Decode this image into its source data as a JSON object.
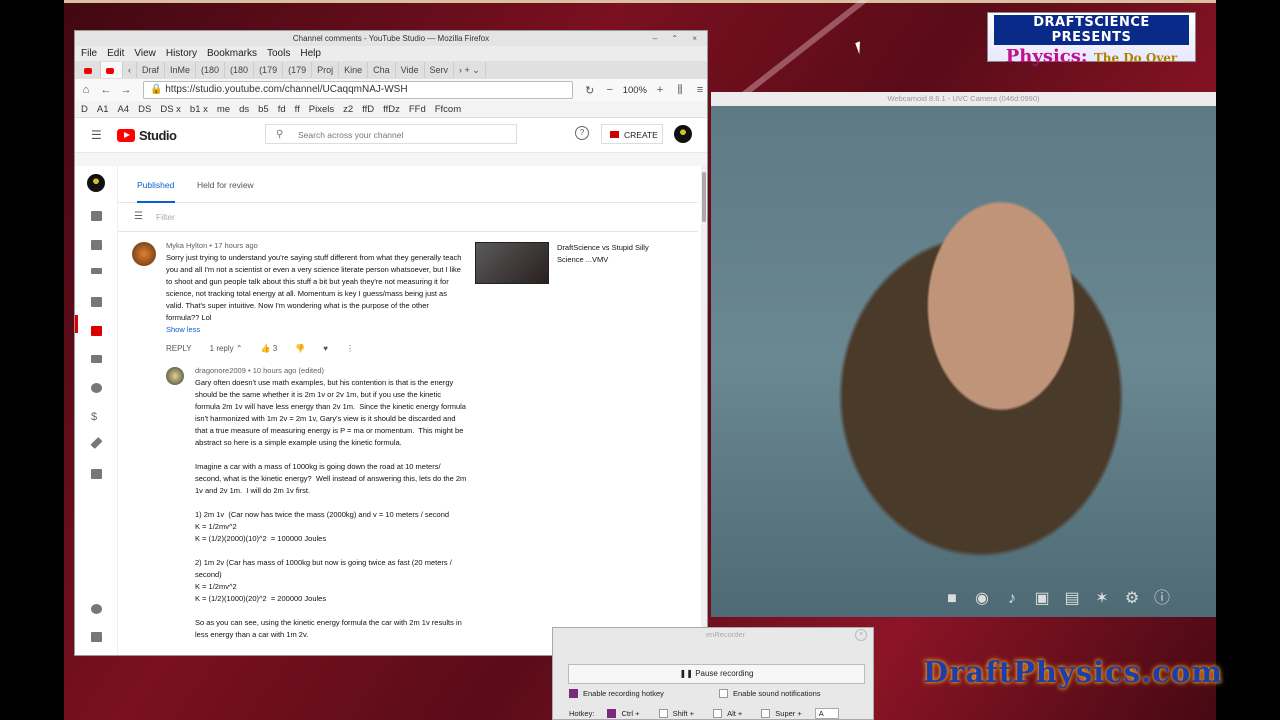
{
  "banner": {
    "line1": "DRAFTSCIENCE PRESENTS",
    "line2": "Physics:",
    "line2_sub": "The Do Over"
  },
  "firefox": {
    "title": "Channel comments - YouTube Studio — Mozilla Firefox",
    "menu": [
      "File",
      "Edit",
      "View",
      "History",
      "Bookmarks",
      "Tools",
      "Help"
    ],
    "tabs": [
      "Draf",
      "InMe",
      "(180",
      "(180",
      "(179",
      "(179",
      "Proj",
      "Kine",
      "Cha",
      "Vide",
      "Serv"
    ],
    "url": "https://studio.youtube.com/channel/UCaqqmNAJ-WSH",
    "zoom": "100%",
    "bookmarks": [
      "D",
      "A1",
      "A4",
      "DS",
      "DS x",
      "b1 x",
      "me",
      "ds",
      "b5",
      "fd",
      "ff",
      "Pixels",
      "z2",
      "ffD",
      "ffDz",
      "FFd",
      "Ffcom"
    ]
  },
  "studio": {
    "logo_text": "Studio",
    "search_placeholder": "Search across your channel",
    "create_label": "CREATE",
    "tab_published": "Published",
    "tab_held": "Held for review",
    "filter_placeholder": "Filter"
  },
  "comment1": {
    "author": "Myka Hylton",
    "time": "17 hours ago",
    "text": "Sorry just trying to understand you're saying stuff different from what they generally teach\nyou and all I'm not a scientist or even a very science literate person whatsoever, but I like\nto shoot and gun people talk about this stuff a bit but yeah they're not measuring it for\nscience, not tracking total energy at all. Momentum is key I guess/mass being just as\nvalid. That's super intuitive. Now I'm wondering what is the purpose of the other\nformula?? Lol",
    "show_less": "Show less",
    "reply": "REPLY",
    "replies": "1 reply",
    "likes": "3",
    "video_title": "DraftScience vs Stupid Silly Science ...VMV"
  },
  "comment2": {
    "author": "dragonore2009",
    "time": "10 hours ago (edited)",
    "text": "Gary often doesn't use math examples, but his contention is that is the energy\nshould be the same whether it is 2m 1v or 2v 1m, but if you use the kinetic\nformula 2m 1v will have less energy than 2v 1m.  Since the kinetic energy formula\nisn't harmonized with 1m 2v = 2m 1v, Gary's view is it should be discarded and\nthat a true measure of measuring energy is P = ma or momentum.  This might be\nabstract so here is a simple example using the kinetic formula.\n\nImagine a car with a mass of 1000kg is going down the road at 10 meters/\nsecond, what is the kinetic energy?  Well instead of answering this, lets do the 2m\n1v and 2v 1m.  I will do 2m 1v first.\n\n1) 2m 1v  (Car now has twice the mass (2000kg) and v = 10 meters / second\nK = 1/2mv^2\nK = (1/2)(2000)(10)^2  = 100000 Joules\n\n2) 1m 2v (Car has mass of 1000kg but now is going twice as fast (20 meters /\nsecond)\nK = 1/2mv^2\nK = (1/2)(1000)(20)^2  = 200000 Joules\n\nSo as you can see, using the kinetic energy formula the car with 2m 1v results in\nless energy than a car with 1m 2v."
  },
  "webcam": {
    "title": "Webcamoid 8.6.1 - UVC Camera (046d:0990)"
  },
  "recorder": {
    "title": "enRecorder",
    "pause": "Pause recording",
    "hotkey_opt": "Enable recording hotkey",
    "sound_opt": "Enable sound notifications",
    "hotkey_label": "Hotkey:",
    "mods": [
      "Ctrl +",
      "Shift +",
      "Alt +",
      "Super +"
    ],
    "key": "A"
  },
  "watermark": "DraftPhysics.com"
}
